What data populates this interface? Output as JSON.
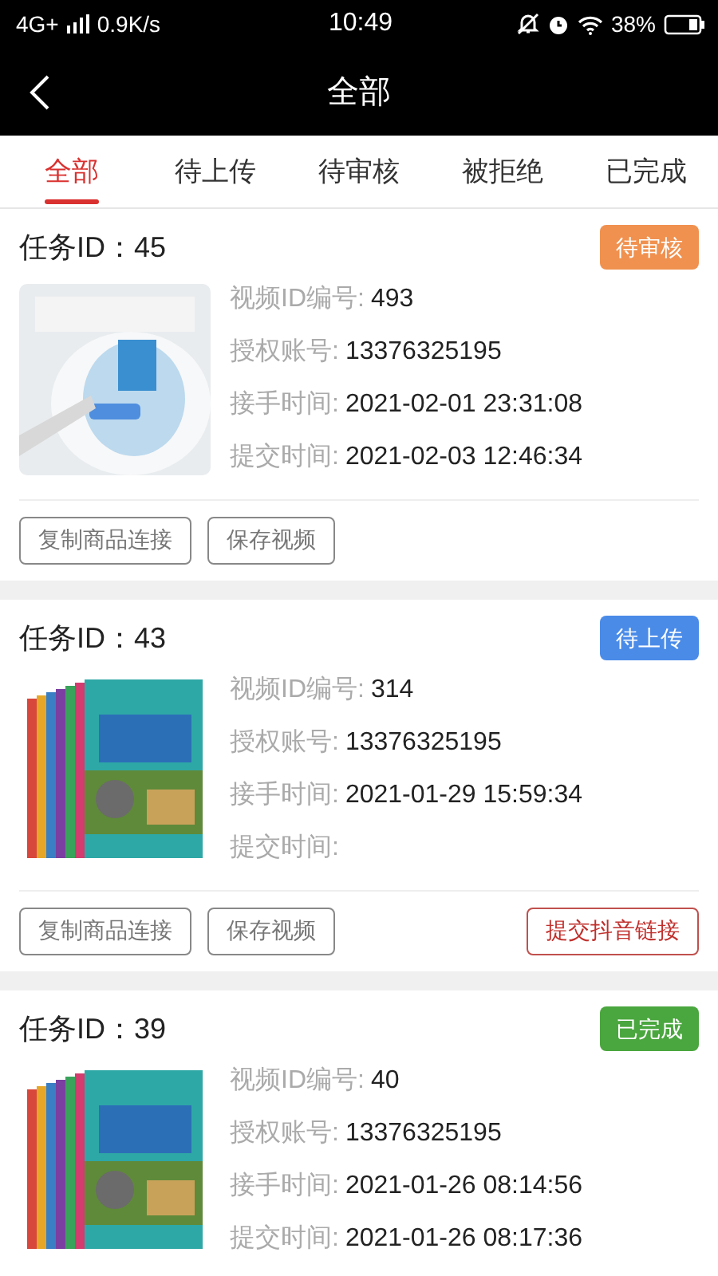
{
  "status_bar": {
    "network": "4G+",
    "speed": "0.9K/s",
    "time": "10:49",
    "battery": "38%"
  },
  "header": {
    "title": "全部"
  },
  "tabs": [
    {
      "label": "全部",
      "selected": true
    },
    {
      "label": "待上传",
      "selected": false
    },
    {
      "label": "待审核",
      "selected": false
    },
    {
      "label": "被拒绝",
      "selected": false
    },
    {
      "label": "已完成",
      "selected": false
    }
  ],
  "tasks": [
    {
      "title": "任务ID：45",
      "status": {
        "label": "待审核",
        "color": "#f0914f"
      },
      "picture": {
        "kind": "picture"
      },
      "fields": [
        {
          "label": "视频ID编号:",
          "value": "493"
        },
        {
          "label": "授权账号:",
          "value": "13376325195"
        },
        {
          "label": "接手时间:",
          "value": "2021-02-01 23:31:08"
        },
        {
          "label": "提交时间:",
          "value": "2021-02-03 12:46:34"
        }
      ],
      "buttons": [
        {
          "label": "复制商品连接",
          "kind": "plain"
        },
        {
          "label": "保存视频",
          "kind": "plain"
        }
      ]
    },
    {
      "title": "任务ID：43",
      "status": {
        "label": "待上传",
        "color": "#4a8be8"
      },
      "picture": {
        "kind": "picture"
      },
      "fields": [
        {
          "label": "视频ID编号:",
          "value": "314"
        },
        {
          "label": "授权账号:",
          "value": "13376325195"
        },
        {
          "label": "接手时间:",
          "value": "2021-01-29 15:59:34"
        },
        {
          "label": "提交时间:"
        }
      ],
      "buttons": [
        {
          "label": "复制商品连接",
          "kind": "plain"
        },
        {
          "label": "保存视频",
          "kind": "plain"
        },
        {
          "label": "提交抖音链接",
          "kind": "primary"
        }
      ]
    },
    {
      "title": "任务ID：39",
      "status": {
        "label": "已完成",
        "color": "#4aa63e"
      },
      "picture": {
        "kind": "picture"
      },
      "fields": [
        {
          "label": "视频ID编号:",
          "value": "40"
        },
        {
          "label": "授权账号:",
          "value": "13376325195"
        },
        {
          "label": "接手时间:",
          "value": "2021-01-26 08:14:56"
        },
        {
          "label": "提交时间:",
          "value": "2021-01-26 08:17:36"
        }
      ]
    }
  ]
}
